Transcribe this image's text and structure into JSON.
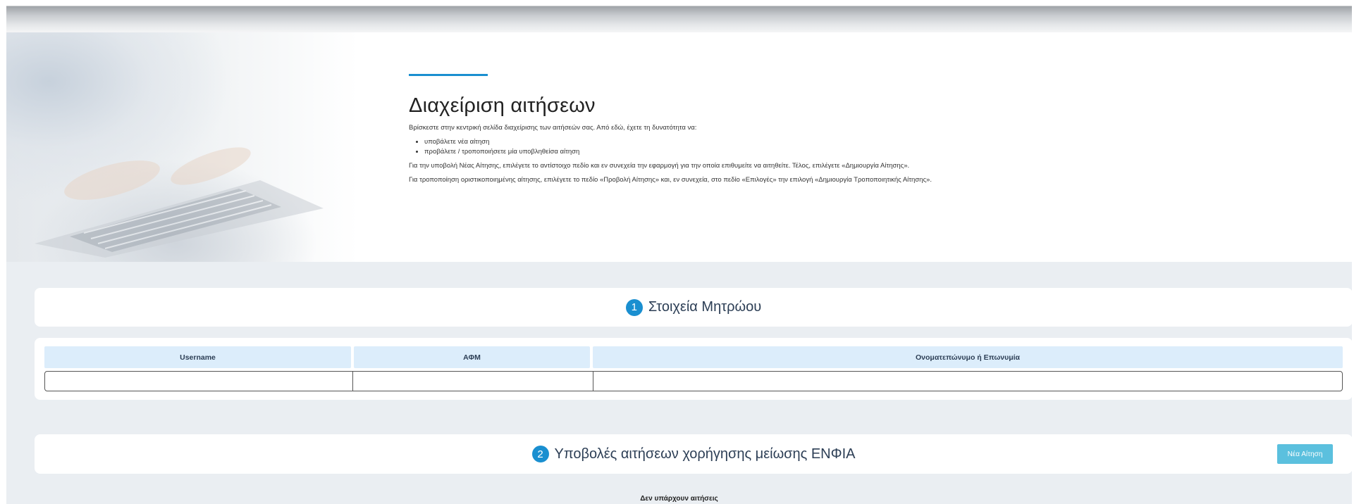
{
  "hero": {
    "title": "Διαχείριση αιτήσεων",
    "intro": "Βρίσκεστε στην κεντρική σελίδα διαχείρισης των αιτήσεών σας. Από εδώ, έχετε τη δυνατότητα να:",
    "bullets": [
      "υποβάλετε νέα αίτηση",
      "προβάλετε / τροποποιήσετε μία υποβληθείσα αίτηση"
    ],
    "paragraph_new": "Για την υποβολή Νέας Αίτησης, επιλέγετε το αντίστοιχο πεδίο και εν συνεχεία την εφαρμογή για την οποία επιθυμείτε να αιτηθείτε. Τέλος, επιλέγετε «Δημιουργία Αίτησης».",
    "paragraph_modify": "Για τροποποίηση οριστικοποιημένης αίτησης, επιλέγετε το πεδίο «Προβολή Αίτησης» και, εν συνεχεία, στο πεδίο «Επιλογές» την επιλογή «Δημιουργία Τροποποιητικής Αίτησης»."
  },
  "registry": {
    "number": "1",
    "title": "Στοιχεία Μητρώου",
    "columns": [
      "Username",
      "ΑΦΜ",
      "Ονοματεπώνυμο ή Επωνυμία"
    ],
    "row": [
      "",
      "",
      ""
    ]
  },
  "submissions": {
    "number": "2",
    "title": "Υποβολές αιτήσεων χορήγησης μείωσης ΕΝΦΙΑ",
    "new_button": "Νέα Αίτηση",
    "empty_message": "Δεν υπάρχουν αιτήσεις"
  },
  "colors": {
    "accent": "#1a8fd0",
    "header_cell": "#dcedfb",
    "button": "#5bc0de",
    "background": "#eaeef2"
  }
}
